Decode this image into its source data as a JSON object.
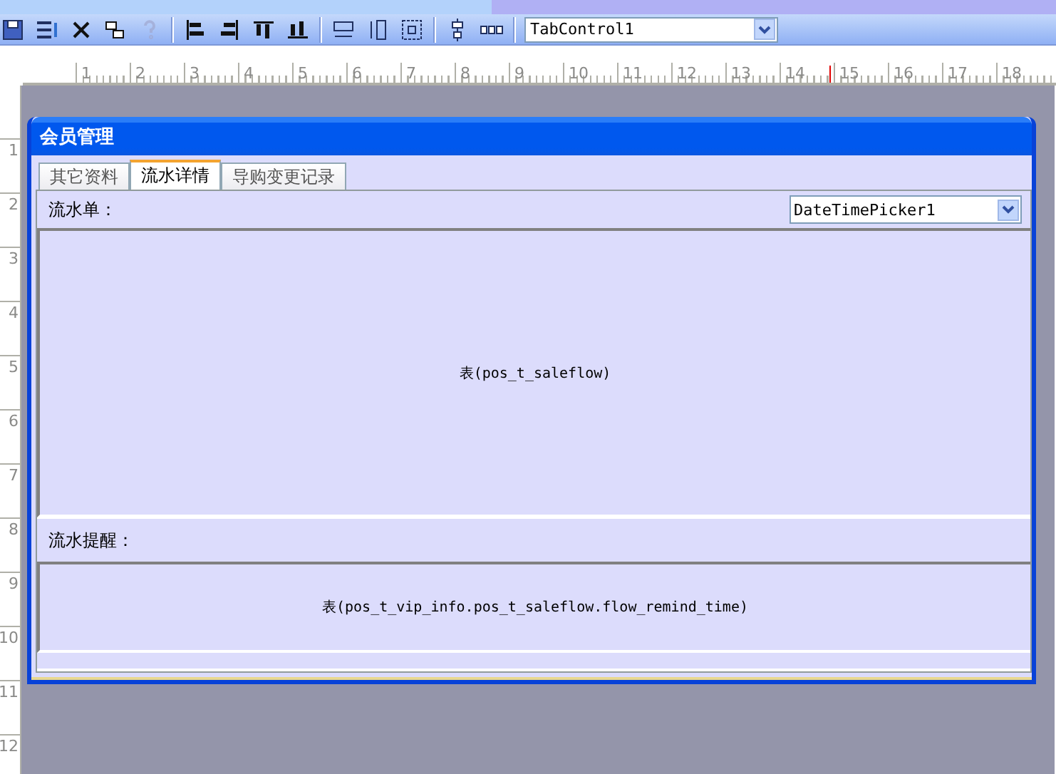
{
  "toolbar": {
    "buttons": [
      {
        "kind": "save",
        "disabled": false
      },
      {
        "kind": "properties",
        "disabled": false
      },
      {
        "kind": "delete",
        "disabled": false
      },
      {
        "kind": "copy",
        "disabled": false
      },
      {
        "kind": "help",
        "disabled": true
      },
      {
        "kind": "sep"
      },
      {
        "kind": "align-left",
        "disabled": false
      },
      {
        "kind": "align-right",
        "disabled": false
      },
      {
        "kind": "align-top",
        "disabled": false
      },
      {
        "kind": "align-bottom",
        "disabled": false
      },
      {
        "kind": "sep"
      },
      {
        "kind": "same-width",
        "disabled": false
      },
      {
        "kind": "same-height",
        "disabled": false
      },
      {
        "kind": "same-size",
        "disabled": false
      },
      {
        "kind": "sep"
      },
      {
        "kind": "center-vertical",
        "disabled": false
      },
      {
        "kind": "spacing",
        "disabled": false
      }
    ],
    "combo": {
      "value": "TabControl1"
    }
  },
  "ruler": {
    "horizontal": [
      "1",
      "2",
      "3",
      "4",
      "5",
      "6",
      "7",
      "8",
      "9",
      "10",
      "11",
      "12",
      "13",
      "14",
      "15",
      "16",
      "17",
      "18"
    ],
    "vertical": [
      "1",
      "2",
      "3",
      "4",
      "5",
      "6",
      "7",
      "8",
      "9",
      "10",
      "11",
      "12"
    ]
  },
  "window": {
    "title": "会员管理"
  },
  "tabs": [
    {
      "label": "其它资料",
      "selected": false
    },
    {
      "label": "流水详情",
      "selected": true
    },
    {
      "label": "导购变更记录",
      "selected": false
    }
  ],
  "panel": {
    "label": "流水单：",
    "date_picker": {
      "value": "DateTimePicker1"
    },
    "table": "表(pos_t_saleflow)",
    "reminder_label": "流水提醒：",
    "reminder_table": "表(pos_t_vip_info.pos_t_saleflow.flow_remind_time)"
  }
}
